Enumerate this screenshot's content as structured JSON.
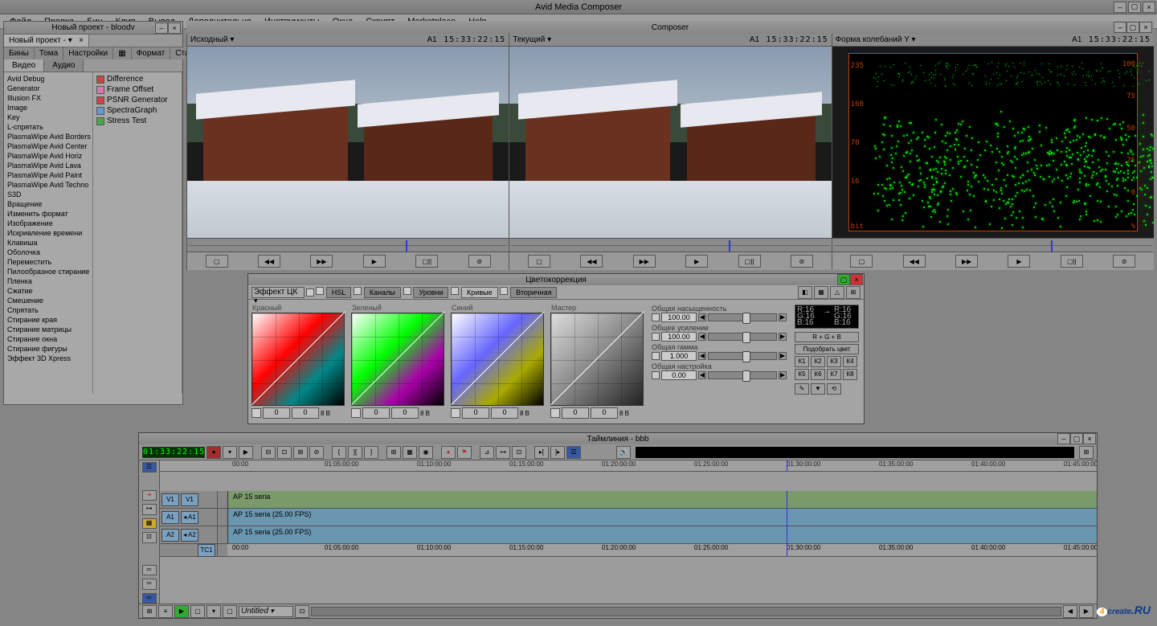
{
  "app": {
    "title": "Avid Media Composer"
  },
  "menu": [
    "Файл",
    "Правка",
    "Бин",
    "Клип",
    "Вывод",
    "Дополнительно",
    "Инструменты",
    "Окна",
    "Скрипт",
    "Marketplace",
    "Help"
  ],
  "project": {
    "title": "Новый проект - bloodv",
    "tab": "Новый проект -",
    "tabs1": [
      "Бины",
      "Тома",
      "Настройки",
      "▦",
      "Формат",
      "Статисти"
    ],
    "tabs2": [
      "Видео",
      "Аудио"
    ],
    "active_tab2": 0,
    "col1": [
      "Avid Debug",
      "Generator",
      "Illusion FX",
      "Image",
      "Key",
      "L-спрятать",
      "PlasmaWipe Avid Borders",
      "PlasmaWipe Avid Center",
      "PlasmaWipe Avid Horiz",
      "PlasmaWipe Avid Lava",
      "PlasmaWipe Avid Paint",
      "PlasmaWipe Avid Techno",
      "S3D",
      "Вращение",
      "Изменить формат",
      "Изображение",
      "Искривление времени",
      "Клавиша",
      "Оболочка",
      "Переместить",
      "Пилообразное стирание",
      "Пленка",
      "Сжатие",
      "Смешение",
      "Спрятать",
      "Стирание края",
      "Стирание матрицы",
      "Стирание окна",
      "Стирание фигуры",
      "Эффект 3D Xpress"
    ],
    "col2": [
      {
        "icon": "red",
        "label": "Difference"
      },
      {
        "icon": "pink",
        "label": "Frame Offset"
      },
      {
        "icon": "red",
        "label": "PSNR Generator"
      },
      {
        "icon": "blue",
        "label": "SpectraGraph"
      },
      {
        "icon": "grn",
        "label": "Stress Test"
      }
    ]
  },
  "composer": {
    "title": "Composer",
    "monitors": [
      {
        "label": "Исходный",
        "track": "A1",
        "tc": "15:33:22:15",
        "marker": 68
      },
      {
        "label": "Текущий",
        "track": "A1",
        "tc": "15:33:22:15",
        "marker": 68
      },
      {
        "label": "Форма колебаний Y",
        "track": "A1",
        "tc": "15:33:22:15",
        "marker": 68
      }
    ],
    "wf_left": [
      "235",
      "160",
      "70",
      "16"
    ],
    "wf_right": [
      "100",
      "75",
      "50",
      "25",
      "0"
    ],
    "wf_bits": "bit",
    "wf_pct": "%",
    "controls": [
      "▢",
      "◀◀",
      "▶▶",
      "▶",
      "▢||",
      "⊘"
    ]
  },
  "colorcor": {
    "title": "Цветокоррекция",
    "dropdown": "Эффект ЦК",
    "tabs": [
      "HSL",
      "Каналы",
      "Уровни",
      "Кривые",
      "Вторичная"
    ],
    "active": 3,
    "curves": [
      {
        "label": "Красный",
        "cls": "red"
      },
      {
        "label": "Зеленый",
        "cls": "green"
      },
      {
        "label": "Синий",
        "cls": "blue"
      },
      {
        "label": "Мастер",
        "cls": "master"
      }
    ],
    "num_vals": [
      "0",
      "0"
    ],
    "num_unit": "8 В",
    "sliders": [
      {
        "label": "Общая насыщенность",
        "val": "100.00"
      },
      {
        "label": "Общее усиление",
        "val": "100.00"
      },
      {
        "label": "Общая гамма",
        "val": "1.000"
      },
      {
        "label": "Общая настройка",
        "val": "0.00"
      }
    ],
    "swatch": [
      "R:16",
      "G:16",
      "B:16"
    ],
    "rgb_btn": "R + G + B",
    "pick_btn": "Подобрать цвет",
    "k_buttons": [
      "К1",
      "К2",
      "К3",
      "К4",
      "К5",
      "К6",
      "К7",
      "К8"
    ]
  },
  "timeline": {
    "title": "Таймлиния - bbb",
    "tc": "01:33:22:15",
    "ruler": [
      "00:00",
      "01:05:00:00",
      "01:10:00:00",
      "01:15:00:00",
      "01:20:00:00",
      "01:25:00:00",
      "01:30:00:00",
      "01:35:00:00",
      "01:40:00:00",
      "01:45:00:00"
    ],
    "tracks": [
      {
        "btns": [
          "V1",
          "V1"
        ],
        "label": "AP 15 seria",
        "cls": "grn"
      },
      {
        "btns": [
          "A1",
          "◂ A1"
        ],
        "label": "AP 15 seria (25.00 FPS)",
        "cls": ""
      },
      {
        "btns": [
          "A2",
          "◂ A2"
        ],
        "label": "AP 15 seria (25.00 FPS)",
        "cls": ""
      }
    ],
    "tc_row": {
      "label": "TC1",
      "ruler": [
        "00:00",
        "01:05:00:00",
        "01:10:00:00",
        "01:15:00:00",
        "01:20:00:00",
        "01:25:00:00",
        "01:30:00:00",
        "01:35:00:00",
        "01:40:00:00",
        "01:45:00:00"
      ]
    },
    "bottom_dd": "Untitled"
  },
  "watermark": {
    "c": "4",
    "txt": "create",
    "ru": ".RU"
  }
}
